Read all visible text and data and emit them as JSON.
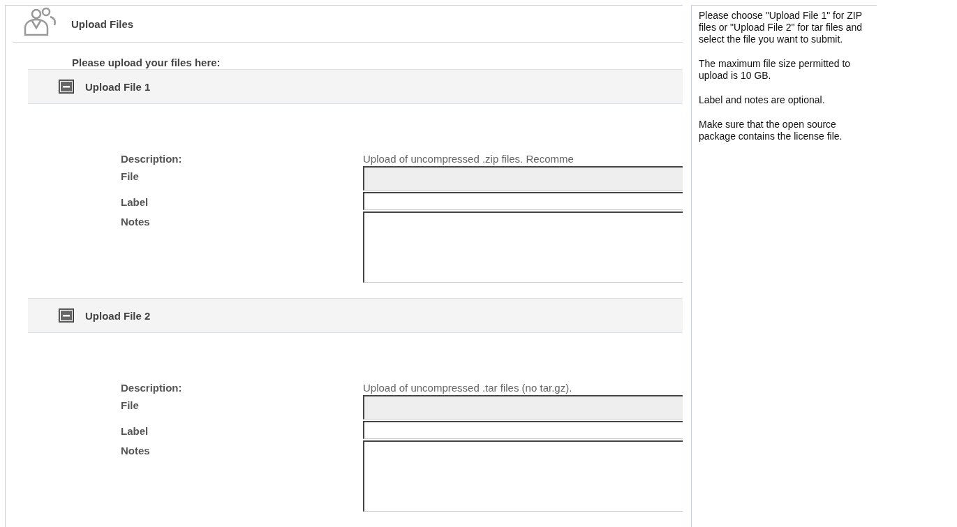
{
  "header": {
    "title": "Upload Files"
  },
  "intro": "Please upload your files here:",
  "sections": [
    {
      "title": "Upload File 1",
      "expanded": true,
      "fields": [
        {
          "kind": "text",
          "label": "Description:",
          "value": "Upload of uncompressed .zip files. Recomme"
        },
        {
          "kind": "file",
          "label": "File"
        },
        {
          "kind": "input",
          "label": "Label"
        },
        {
          "kind": "textarea",
          "label": "Notes"
        }
      ]
    },
    {
      "title": "Upload File 2",
      "expanded": true,
      "fields": [
        {
          "kind": "text",
          "label": "Description:",
          "value": "Upload of uncompressed .tar files (no tar.gz)."
        },
        {
          "kind": "file",
          "label": "File"
        },
        {
          "kind": "input",
          "label": "Label"
        },
        {
          "kind": "textarea",
          "label": "Notes"
        }
      ]
    }
  ],
  "help": [
    "Please choose \"Upload File 1\" for ZIP files or \"Upload File 2\" for tar files and select the file you want to submit.",
    "The maximum file size permitted to upload is 10 GB.",
    "Label and notes are optional.",
    "Make sure that the open source package contains the license file."
  ]
}
